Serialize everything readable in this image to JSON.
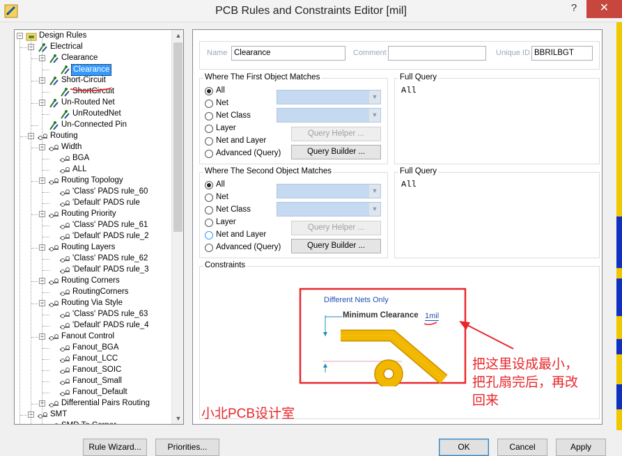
{
  "window": {
    "title": "PCB Rules and Constraints Editor [mil]",
    "help": "?",
    "close": "✕"
  },
  "tree": {
    "items": [
      {
        "label": "Design Rules",
        "level": 0,
        "expander": "−",
        "icon": "rules-folder-icon"
      },
      {
        "label": "Electrical",
        "level": 1,
        "expander": "−",
        "icon": "electrical-icon"
      },
      {
        "label": "Clearance",
        "level": 2,
        "expander": "−",
        "icon": "electrical-icon"
      },
      {
        "label": "Clearance",
        "level": 3,
        "expander": "",
        "icon": "rule-icon",
        "selected": true
      },
      {
        "label": "Short-Circuit",
        "level": 2,
        "expander": "−",
        "icon": "electrical-icon"
      },
      {
        "label": "ShortCircuit",
        "level": 3,
        "expander": "",
        "icon": "rule-icon"
      },
      {
        "label": "Un-Routed Net",
        "level": 2,
        "expander": "−",
        "icon": "electrical-icon"
      },
      {
        "label": "UnRoutedNet",
        "level": 3,
        "expander": "",
        "icon": "rule-icon"
      },
      {
        "label": "Un-Connected Pin",
        "level": 2,
        "expander": "",
        "icon": "electrical-icon"
      },
      {
        "label": "Routing",
        "level": 1,
        "expander": "−",
        "icon": "routing-icon"
      },
      {
        "label": "Width",
        "level": 2,
        "expander": "−",
        "icon": "routing-icon"
      },
      {
        "label": "BGA",
        "level": 3,
        "expander": "",
        "icon": "routing-rule-icon"
      },
      {
        "label": "ALL",
        "level": 3,
        "expander": "",
        "icon": "routing-rule-icon"
      },
      {
        "label": "Routing Topology",
        "level": 2,
        "expander": "−",
        "icon": "routing-icon"
      },
      {
        "label": "'Class' PADS rule_60",
        "level": 3,
        "expander": "",
        "icon": "routing-rule-icon"
      },
      {
        "label": "'Default' PADS rule",
        "level": 3,
        "expander": "",
        "icon": "routing-rule-icon"
      },
      {
        "label": "Routing Priority",
        "level": 2,
        "expander": "−",
        "icon": "routing-icon"
      },
      {
        "label": "'Class' PADS rule_61",
        "level": 3,
        "expander": "",
        "icon": "routing-rule-icon"
      },
      {
        "label": "'Default' PADS rule_2",
        "level": 3,
        "expander": "",
        "icon": "routing-rule-icon"
      },
      {
        "label": "Routing Layers",
        "level": 2,
        "expander": "−",
        "icon": "routing-icon"
      },
      {
        "label": "'Class' PADS rule_62",
        "level": 3,
        "expander": "",
        "icon": "routing-rule-icon"
      },
      {
        "label": "'Default' PADS rule_3",
        "level": 3,
        "expander": "",
        "icon": "routing-rule-icon"
      },
      {
        "label": "Routing Corners",
        "level": 2,
        "expander": "−",
        "icon": "routing-icon"
      },
      {
        "label": "RoutingCorners",
        "level": 3,
        "expander": "",
        "icon": "routing-rule-icon"
      },
      {
        "label": "Routing Via Style",
        "level": 2,
        "expander": "−",
        "icon": "routing-icon"
      },
      {
        "label": "'Class' PADS rule_63",
        "level": 3,
        "expander": "",
        "icon": "routing-rule-icon"
      },
      {
        "label": "'Default' PADS rule_4",
        "level": 3,
        "expander": "",
        "icon": "routing-rule-icon"
      },
      {
        "label": "Fanout Control",
        "level": 2,
        "expander": "−",
        "icon": "routing-icon"
      },
      {
        "label": "Fanout_BGA",
        "level": 3,
        "expander": "",
        "icon": "routing-rule-icon"
      },
      {
        "label": "Fanout_LCC",
        "level": 3,
        "expander": "",
        "icon": "routing-rule-icon"
      },
      {
        "label": "Fanout_SOIC",
        "level": 3,
        "expander": "",
        "icon": "routing-rule-icon"
      },
      {
        "label": "Fanout_Small",
        "level": 3,
        "expander": "",
        "icon": "routing-rule-icon"
      },
      {
        "label": "Fanout_Default",
        "level": 3,
        "expander": "",
        "icon": "routing-rule-icon"
      },
      {
        "label": "Differential Pairs Routing",
        "level": 2,
        "expander": "+",
        "icon": "routing-icon"
      },
      {
        "label": "SMT",
        "level": 1,
        "expander": "−",
        "icon": "routing-icon"
      },
      {
        "label": "SMD To Corner",
        "level": 2,
        "expander": "",
        "icon": "routing-icon"
      }
    ]
  },
  "header": {
    "name_label": "Name",
    "name_value": "Clearance",
    "comment_label": "Comment",
    "comment_value": "",
    "uid_label": "Unique ID",
    "uid_value": "BBRILBGT"
  },
  "first_match": {
    "title": "Where The First Object Matches",
    "options": [
      "All",
      "Net",
      "Net Class",
      "Layer",
      "Net and Layer",
      "Advanced (Query)"
    ],
    "selected": "All",
    "query_helper": "Query Helper ...",
    "query_builder": "Query Builder ...",
    "full_query_title": "Full Query",
    "full_query": "All"
  },
  "second_match": {
    "title": "Where The Second Object Matches",
    "options": [
      "All",
      "Net",
      "Net Class",
      "Layer",
      "Net and Layer",
      "Advanced (Query)"
    ],
    "selected": "All",
    "query_helper": "Query Helper ...",
    "query_builder": "Query Builder ...",
    "full_query_title": "Full Query",
    "full_query": "All"
  },
  "constraints": {
    "title": "Constraints",
    "net_scope": "Different Nets Only",
    "min_clearance_label": "Minimum Clearance",
    "min_clearance_value": "1mil"
  },
  "annotation": {
    "note_line1": "把这里设成最小，",
    "note_line2": "把孔扇完后，再改",
    "note_line3": "回来",
    "watermark": "小北PCB设计室",
    "color": "#e8262a"
  },
  "footer": {
    "rule_wizard": "Rule Wizard...",
    "priorities": "Priorities...",
    "ok": "OK",
    "cancel": "Cancel",
    "apply": "Apply"
  },
  "colors": {
    "selection": "#3399ff",
    "combo_fill": "#c5d9f1",
    "track": "#f0b400",
    "link": "#1f4fb4"
  }
}
